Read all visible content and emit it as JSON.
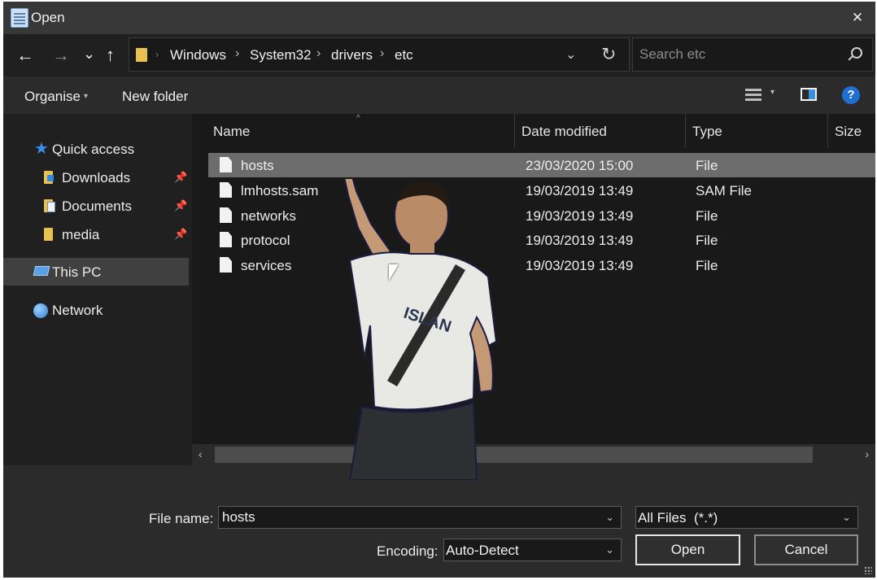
{
  "window": {
    "title": "Open",
    "icon": "notepad-icon",
    "close_glyph": "✕"
  },
  "nav": {
    "back_glyph": "←",
    "forward_glyph": "→",
    "recent_glyph": "⌄",
    "up_glyph": "↑",
    "breadcrumbs": [
      "Windows",
      "System32",
      "drivers",
      "etc"
    ],
    "refresh_glyph": "↻",
    "search_placeholder": "Search etc"
  },
  "commands": {
    "organise": "Organise",
    "new_folder": "New folder",
    "help_glyph": "?"
  },
  "sidebar": {
    "items": [
      {
        "label": "Quick access",
        "icon": "star-icon",
        "pinned": false
      },
      {
        "label": "Downloads",
        "icon": "downloads-folder-icon",
        "pinned": true
      },
      {
        "label": "Documents",
        "icon": "documents-folder-icon",
        "pinned": true
      },
      {
        "label": "media",
        "icon": "folder-icon",
        "pinned": true
      },
      {
        "label": "This PC",
        "icon": "computer-icon",
        "pinned": false,
        "selected": true
      },
      {
        "label": "Network",
        "icon": "network-icon",
        "pinned": false
      }
    ]
  },
  "columns": {
    "name": "Name",
    "date_modified": "Date modified",
    "type": "Type",
    "size": "Size"
  },
  "files": [
    {
      "name": "hosts",
      "date": "23/03/2020 15:00",
      "type": "File",
      "selected": true
    },
    {
      "name": "lmhosts.sam",
      "date": "19/03/2019 13:49",
      "type": "SAM File"
    },
    {
      "name": "networks",
      "date": "19/03/2019 13:49",
      "type": "File"
    },
    {
      "name": "protocol",
      "date": "19/03/2019 13:49",
      "type": "File"
    },
    {
      "name": "services",
      "date": "19/03/2019 13:49",
      "type": "File"
    }
  ],
  "footer": {
    "file_name_label": "File name:",
    "file_name_value": "hosts",
    "file_type_value": "All Files  (*.*)",
    "encoding_label": "Encoding:",
    "encoding_value": "Auto-Detect",
    "open_label": "Open",
    "cancel_label": "Cancel"
  },
  "colors": {
    "window_bg": "#2b2b2b",
    "list_bg": "#191919",
    "selection": "#6c6c6c",
    "accent": "#1f6fd0"
  }
}
